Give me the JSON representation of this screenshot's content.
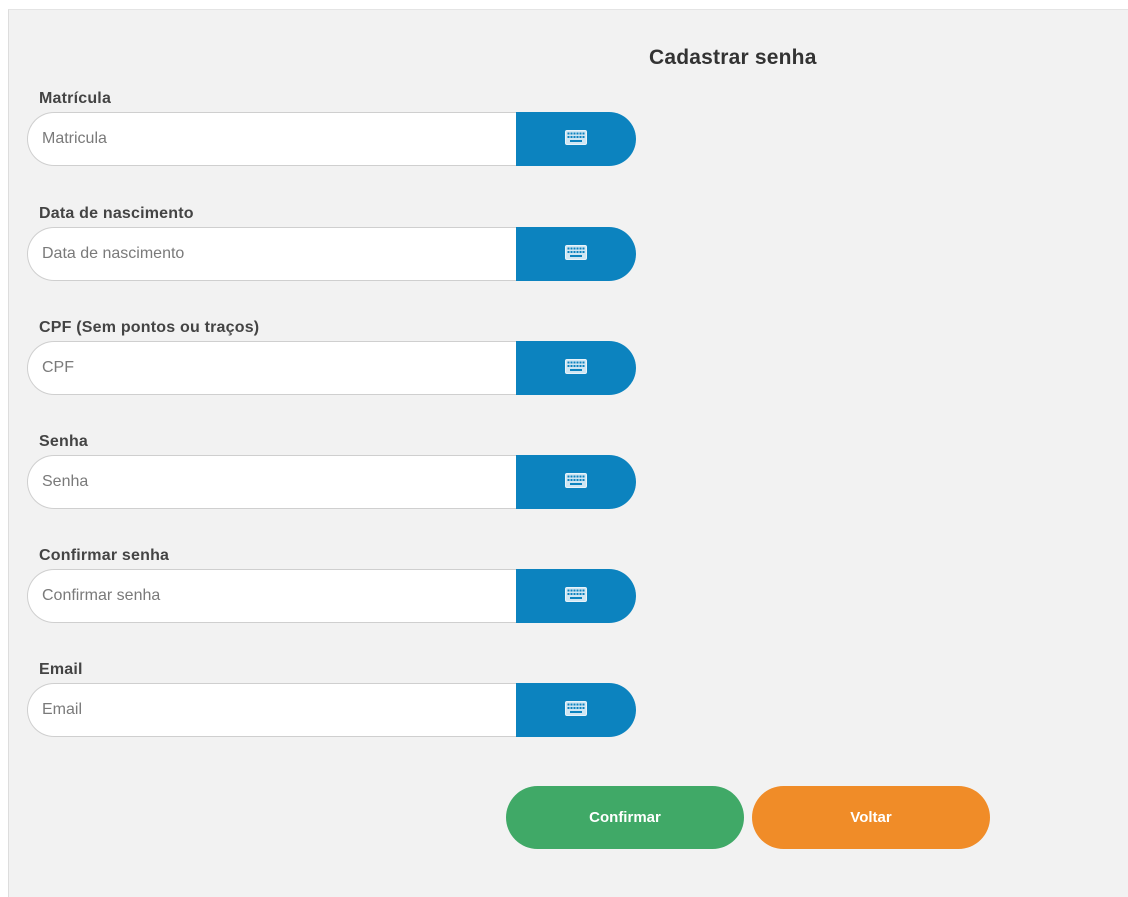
{
  "page": {
    "title": "Cadastrar senha"
  },
  "fields": [
    {
      "label": "Matrícula",
      "placeholder": "Matricula",
      "value": ""
    },
    {
      "label": "Data de nascimento",
      "placeholder": "Data de nascimento",
      "value": ""
    },
    {
      "label": "CPF (Sem pontos ou traços)",
      "placeholder": "CPF",
      "value": ""
    },
    {
      "label": "Senha",
      "placeholder": "Senha",
      "value": ""
    },
    {
      "label": "Confirmar senha",
      "placeholder": "Confirmar senha",
      "value": ""
    },
    {
      "label": "Email",
      "placeholder": "Email",
      "value": ""
    }
  ],
  "buttons": {
    "confirm_label": "Confirmar",
    "back_label": "Voltar"
  },
  "icons": {
    "field_button": "keyboard-icon"
  },
  "colors": {
    "background": "#f2f2f2",
    "keyboard_button": "#0c83bf",
    "confirm": "#40a967",
    "back": "#f08c28"
  }
}
